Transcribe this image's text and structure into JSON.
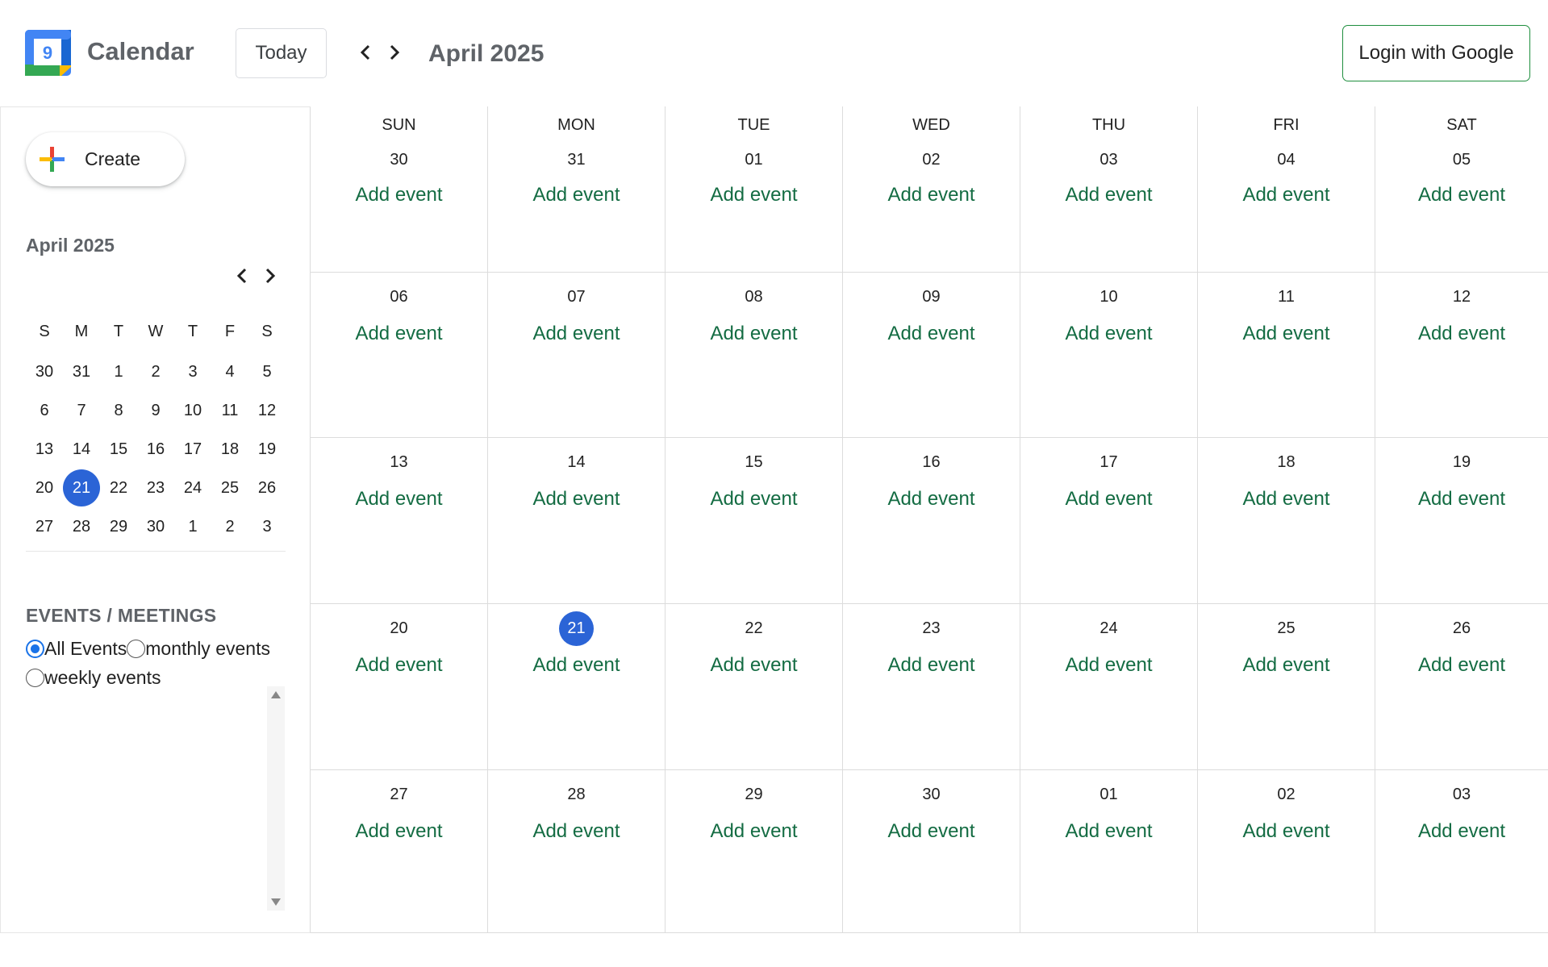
{
  "header": {
    "app_title": "Calendar",
    "logo_number": "9",
    "today_label": "Today",
    "month_title": "April 2025",
    "login_label": "Login with Google"
  },
  "sidebar": {
    "create_label": "Create",
    "mini_calendar": {
      "title": "April 2025",
      "weekdays": [
        "S",
        "M",
        "T",
        "W",
        "T",
        "F",
        "S"
      ],
      "weeks": [
        [
          "30",
          "31",
          "1",
          "2",
          "3",
          "4",
          "5"
        ],
        [
          "6",
          "7",
          "8",
          "9",
          "10",
          "11",
          "12"
        ],
        [
          "13",
          "14",
          "15",
          "16",
          "17",
          "18",
          "19"
        ],
        [
          "20",
          "21",
          "22",
          "23",
          "24",
          "25",
          "26"
        ],
        [
          "27",
          "28",
          "29",
          "30",
          "1",
          "2",
          "3"
        ]
      ],
      "selected_day": "21"
    },
    "events_heading": "EVENTS / MEETINGS",
    "filters": [
      {
        "label": "All Events",
        "checked": true
      },
      {
        "label": "monthly events",
        "checked": false
      },
      {
        "label": "weekly events",
        "checked": false
      }
    ]
  },
  "month_view": {
    "weekdays": [
      "SUN",
      "MON",
      "TUE",
      "WED",
      "THU",
      "FRI",
      "SAT"
    ],
    "add_event_label": "Add event",
    "today": "21",
    "weeks": [
      [
        "30",
        "31",
        "01",
        "02",
        "03",
        "04",
        "05"
      ],
      [
        "06",
        "07",
        "08",
        "09",
        "10",
        "11",
        "12"
      ],
      [
        "13",
        "14",
        "15",
        "16",
        "17",
        "18",
        "19"
      ],
      [
        "20",
        "21",
        "22",
        "23",
        "24",
        "25",
        "26"
      ],
      [
        "27",
        "28",
        "29",
        "30",
        "01",
        "02",
        "03"
      ]
    ]
  },
  "colors": {
    "accent": "#2b64d6",
    "add_event": "#146c43",
    "login_border": "#1e8e3e",
    "muted_title": "#5f6368"
  }
}
